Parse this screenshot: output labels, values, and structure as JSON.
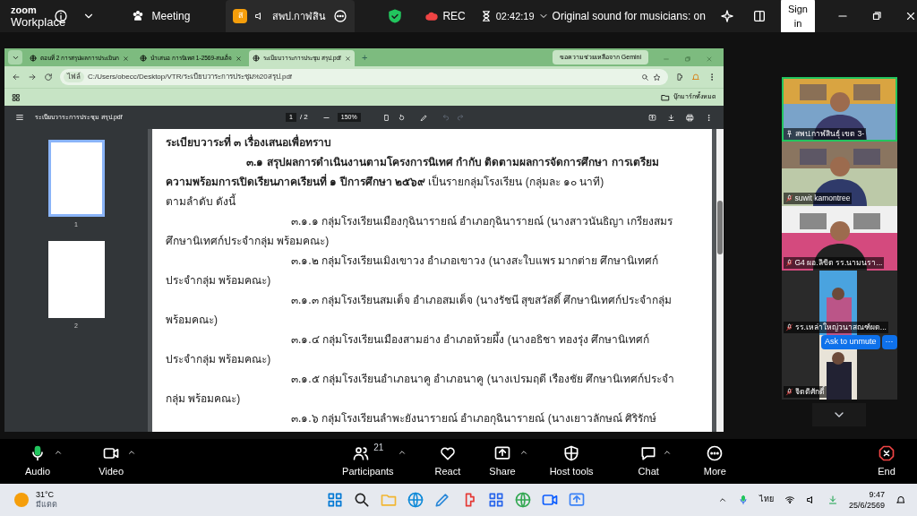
{
  "zoom_bar": {
    "brand_top": "zoom",
    "brand_bottom": "Workplace",
    "meeting": "Meeting",
    "share_badge": "ส",
    "share_tab": "สพป.กาฬสิน",
    "rec": "REC",
    "timer": "02:42:19",
    "sound": "Original sound for musicians: on",
    "sign_in": "Sign in"
  },
  "browser": {
    "tabs": [
      {
        "title": "ตอนที่ 2 การสรุปผลการประเมินก",
        "selected": false
      },
      {
        "title": "นำเสนอ การนิเทศ 1-2569-สมเด็จ",
        "selected": false
      },
      {
        "title": "ระเบียบวาระการประชุม สรุป.pdf",
        "selected": true
      }
    ],
    "new_tab": "+",
    "gemini": "ขอความช่วยเหลือจาก Gemini",
    "scheme": "ไฟล์",
    "url": "C:/Users/obecc/Desktop/VTR/ระเบียบวาระการประชุม%20สรุป.pdf",
    "bookmarks": "บุ๊กมาร์กทั้งหมด"
  },
  "pdf": {
    "file": "ระเบียบวาระการประชุม สรุป.pdf",
    "page": "1",
    "pages": "/ 2",
    "zoom": "150%",
    "thumbnails": [
      {
        "label": "1",
        "selected": true
      },
      {
        "label": "2",
        "selected": false
      }
    ],
    "lines": [
      {
        "kind": "heading",
        "text": "ระเบียบวาระที่ ๓ เรื่องเสนอเพื่อทราบ"
      },
      {
        "kind": "lead",
        "text": "๓.๑  สรุปผลการดำเนินงานตามโครงการนิเทศ กำกับ ติดตามผลการจัดการศึกษา การเตรียม"
      },
      {
        "kind": "plain",
        "text": "**ความพร้อมการเปิดเรียนภาคเรียนที่ ๑ ปีการศึกษา ๒๕๖๙** เป็นรายกลุ่มโรงเรียน (กลุ่มละ ๑๐ นาที)"
      },
      {
        "kind": "plain",
        "text": "ตามลำดับ ดังนี้"
      },
      {
        "kind": "item",
        "text": "๓.๑.๑ กลุ่มโรงเรียนเมืองกุฉินารายณ์ อำเภอกุฉินารายณ์ (นางสาวนันธิญา เกรียงสมร"
      },
      {
        "kind": "plain",
        "text": "ศึกษานิเทศก์ประจำกลุ่ม พร้อมคณะ)"
      },
      {
        "kind": "item",
        "text": "๓.๑.๒ กลุ่มโรงเรียนเมิงเขาวง อำเภอเขาวง (นางสะใบแพร มากต่าย ศึกษานิเทศก์"
      },
      {
        "kind": "plain",
        "text": "ประจำกลุ่ม พร้อมคณะ)"
      },
      {
        "kind": "item",
        "text": "๓.๑.๓ กลุ่มโรงเรียนสมเด็จ อำเภอสมเด็จ (นางรัชนี สุขสวัสดิ์ ศึกษานิเทศก์ประจำกลุ่ม"
      },
      {
        "kind": "plain",
        "text": "พร้อมคณะ)"
      },
      {
        "kind": "item",
        "text": "๓.๑.๔ กลุ่มโรงเรียนเมืองสามอ่าง อำเภอห้วยผึ้ง (นางอธิชา ทองรุ่ง ศึกษานิเทศก์"
      },
      {
        "kind": "plain",
        "text": "ประจำกลุ่ม พร้อมคณะ)"
      },
      {
        "kind": "item",
        "text": "๓.๑.๕ กลุ่มโรงเรียนอำเภอนาคู อำเภอนาคู (นางเปรมฤดี เรืองชัย ศึกษานิเทศก์ประจำ"
      },
      {
        "kind": "plain",
        "text": "กลุ่ม พร้อมคณะ)"
      },
      {
        "kind": "item",
        "text": "๓.๑.๖ กลุ่มโรงเรียนลำพะยังนารายณ์ อำเภอกุฉินารายณ์ (นางเยาวลักษณ์ ศิริรักษ์"
      }
    ]
  },
  "participants": [
    {
      "name": "สพป.กาฬสินธุ์ เขต 3-",
      "kind": "pinned",
      "selected": true
    },
    {
      "name": "suwit kamontree",
      "kind": "muted",
      "selected": false
    },
    {
      "name": "G4 ผอ.ลิขิต  รร.นามนรา...",
      "kind": "muted",
      "selected": false
    },
    {
      "name": "รร.เหล่าใหญ่วนาสณฑ์ผด...",
      "kind": "muted",
      "selected": false
    },
    {
      "name": "จิตติศักดิ์",
      "kind": "muted",
      "selected": false
    }
  ],
  "ask_unmute": "Ask to unmute",
  "more_dots": "···",
  "toolbar": [
    {
      "kind": "audio",
      "label": "Audio"
    },
    {
      "kind": "video",
      "label": "Video"
    },
    {
      "kind": "participants",
      "label": "Participants",
      "count": "21"
    },
    {
      "kind": "react",
      "label": "React"
    },
    {
      "kind": "share",
      "label": "Share"
    },
    {
      "kind": "host",
      "label": "Host tools"
    },
    {
      "kind": "chat",
      "label": "Chat"
    },
    {
      "kind": "more",
      "label": "More"
    },
    {
      "kind": "end",
      "label": "End"
    }
  ],
  "taskbar": {
    "temp": "31°C",
    "weather": "มีแดด",
    "lang": "ไทย",
    "time": "9:47",
    "date": "25/6/2569"
  }
}
